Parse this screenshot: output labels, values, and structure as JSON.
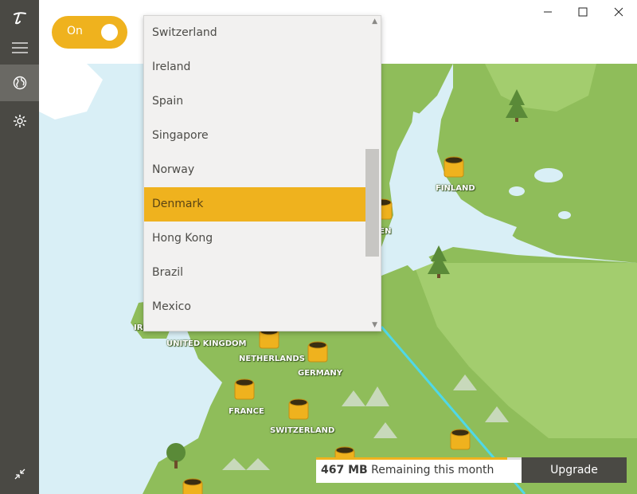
{
  "toggle": {
    "label": "On"
  },
  "window": {
    "minimize_icon": "minimize-icon",
    "maximize_icon": "maximize-icon",
    "close_icon": "close-icon"
  },
  "sidebar": {
    "items": [
      {
        "name": "logo",
        "icon": "tunnelbear-logo-icon"
      },
      {
        "name": "menu",
        "icon": "hamburger-icon"
      },
      {
        "name": "map",
        "icon": "globe-icon",
        "active": true
      },
      {
        "name": "settings",
        "icon": "gear-icon"
      },
      {
        "name": "collapse",
        "icon": "collapse-icon"
      }
    ]
  },
  "dropdown": {
    "options": [
      "Switzerland",
      "Ireland",
      "Spain",
      "Singapore",
      "Norway",
      "Denmark",
      "Hong Kong",
      "Brazil",
      "Mexico"
    ],
    "selected": "Denmark"
  },
  "map": {
    "labels": {
      "finland": "FINLAND",
      "sweden_partial": "DEN",
      "ireland": "IRELAND",
      "uk": "UNITED KINGDOM",
      "netherlands": "NETHERLANDS",
      "germany": "GERMANY",
      "france": "FRANCE",
      "switzerland": "SWITZERLAND"
    }
  },
  "quota": {
    "amount": "467 MB",
    "text": "Remaining this month",
    "used_fraction": 0.93
  },
  "upgrade": {
    "label": "Upgrade"
  },
  "colors": {
    "accent": "#efb21e",
    "sidebar": "#4a4944",
    "land": "#8fbd5a",
    "water": "#d9eff6",
    "route": "#4fd8e8"
  }
}
